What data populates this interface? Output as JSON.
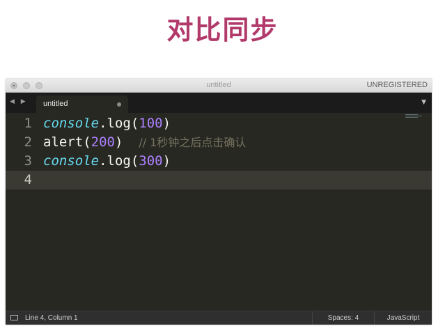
{
  "slide": {
    "title": "对比同步"
  },
  "window": {
    "title": "untitled",
    "license_label": "UNREGISTERED"
  },
  "tabbar": {
    "nav_arrows": "◀ ▶",
    "active_tab": "untitled",
    "menu_arrow": "▼"
  },
  "editor": {
    "lines": [
      {
        "number": "1",
        "object": "console",
        "dot": ".",
        "method": "log(",
        "arg": "100",
        "close": ")"
      },
      {
        "number": "2",
        "func": "alert(",
        "arg": "200",
        "close": ")",
        "comment": "// 1秒钟之后点击确认"
      },
      {
        "number": "3",
        "object": "console",
        "dot": ".",
        "method": "log(",
        "arg": "300",
        "close": ")"
      },
      {
        "number": "4"
      }
    ]
  },
  "statusbar": {
    "position": "Line 4, Column 1",
    "indentation": "Spaces: 4",
    "syntax": "JavaScript"
  },
  "colors": {
    "title_accent": "#b23a6b",
    "editor_bg": "#272822",
    "keyword_object": "#66d9ef",
    "number": "#ae81ff",
    "comment": "#75715e"
  }
}
